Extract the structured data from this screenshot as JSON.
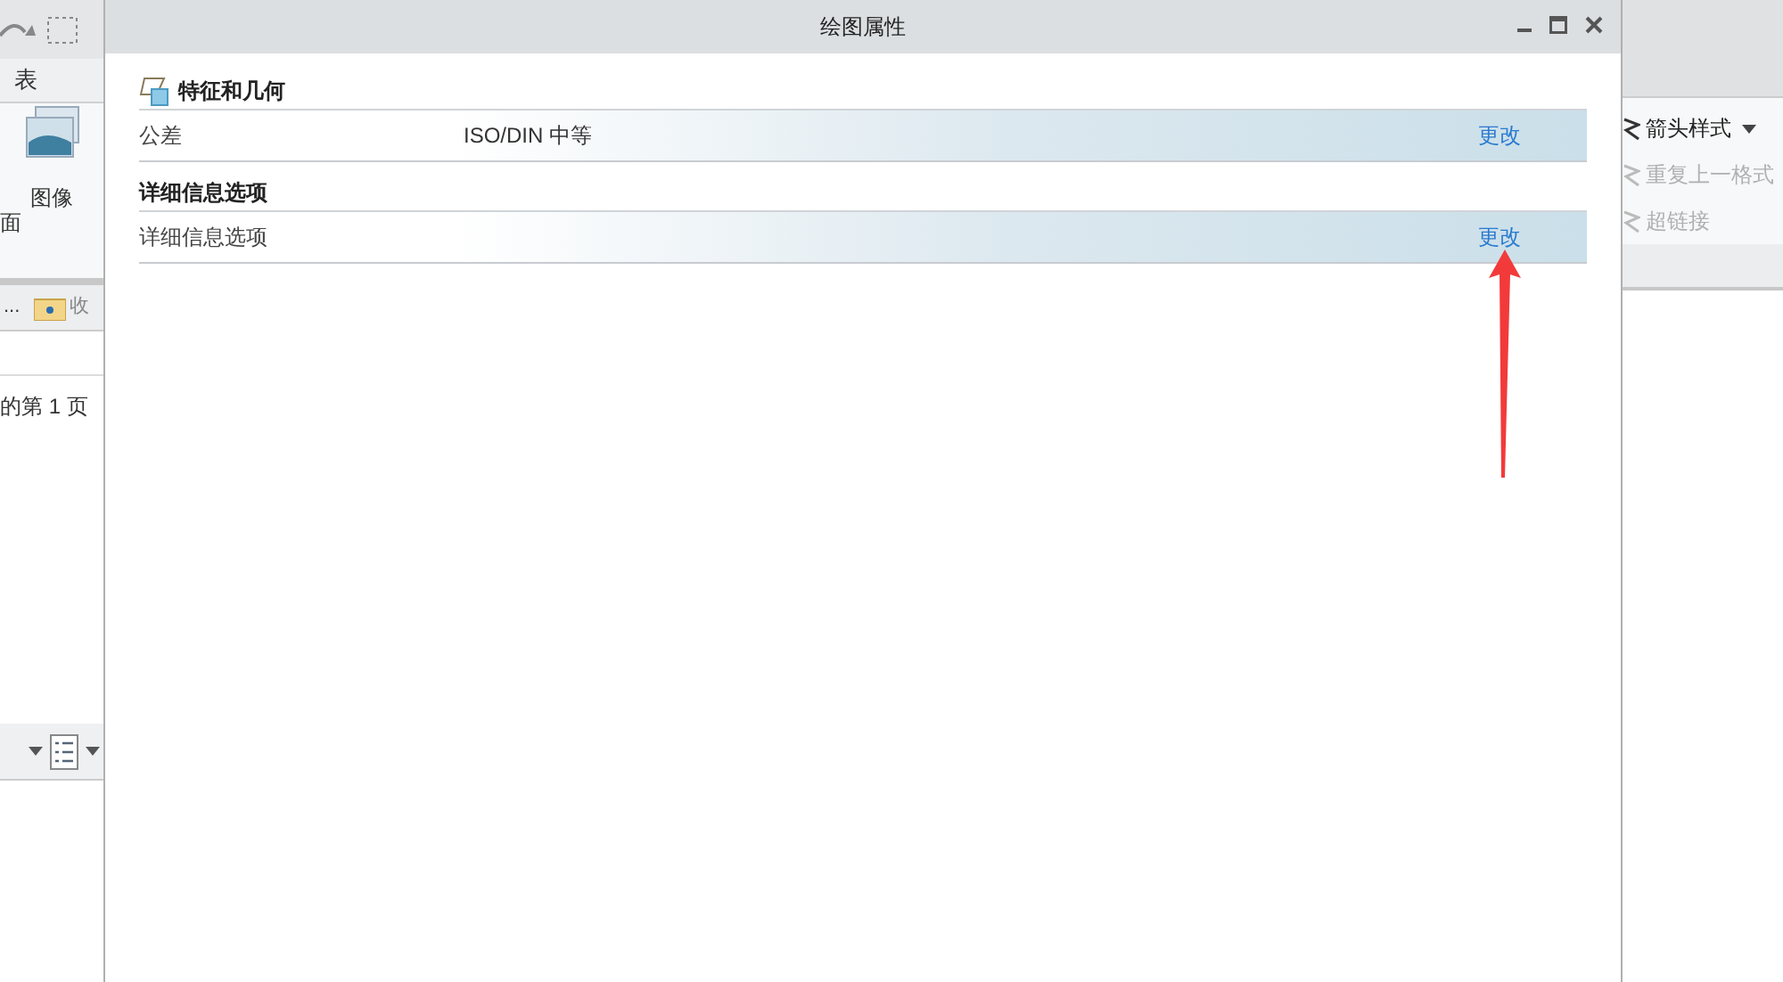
{
  "background_app": {
    "left_tab": "表",
    "left_ribbon_label": "图像",
    "left_cut_label": "面",
    "left_pane_tabs": [
      "...",
      "收"
    ],
    "page_text": "的第 1 页",
    "right_items": [
      {
        "label": "箭头样式",
        "disabled": false,
        "dropdown": true
      },
      {
        "label": "重复上一格式",
        "disabled": true,
        "dropdown": false
      },
      {
        "label": "超链接",
        "disabled": true,
        "dropdown": false
      }
    ]
  },
  "dialog": {
    "title": "绘图属性",
    "sections": [
      {
        "heading": "特征和几何",
        "has_icon": true,
        "rows": [
          {
            "label": "公差",
            "value": "ISO/DIN 中等",
            "action": "更改"
          }
        ]
      },
      {
        "heading": "详细信息选项",
        "has_icon": false,
        "rows": [
          {
            "label": "详细信息选项",
            "action": "更改"
          }
        ]
      }
    ]
  }
}
